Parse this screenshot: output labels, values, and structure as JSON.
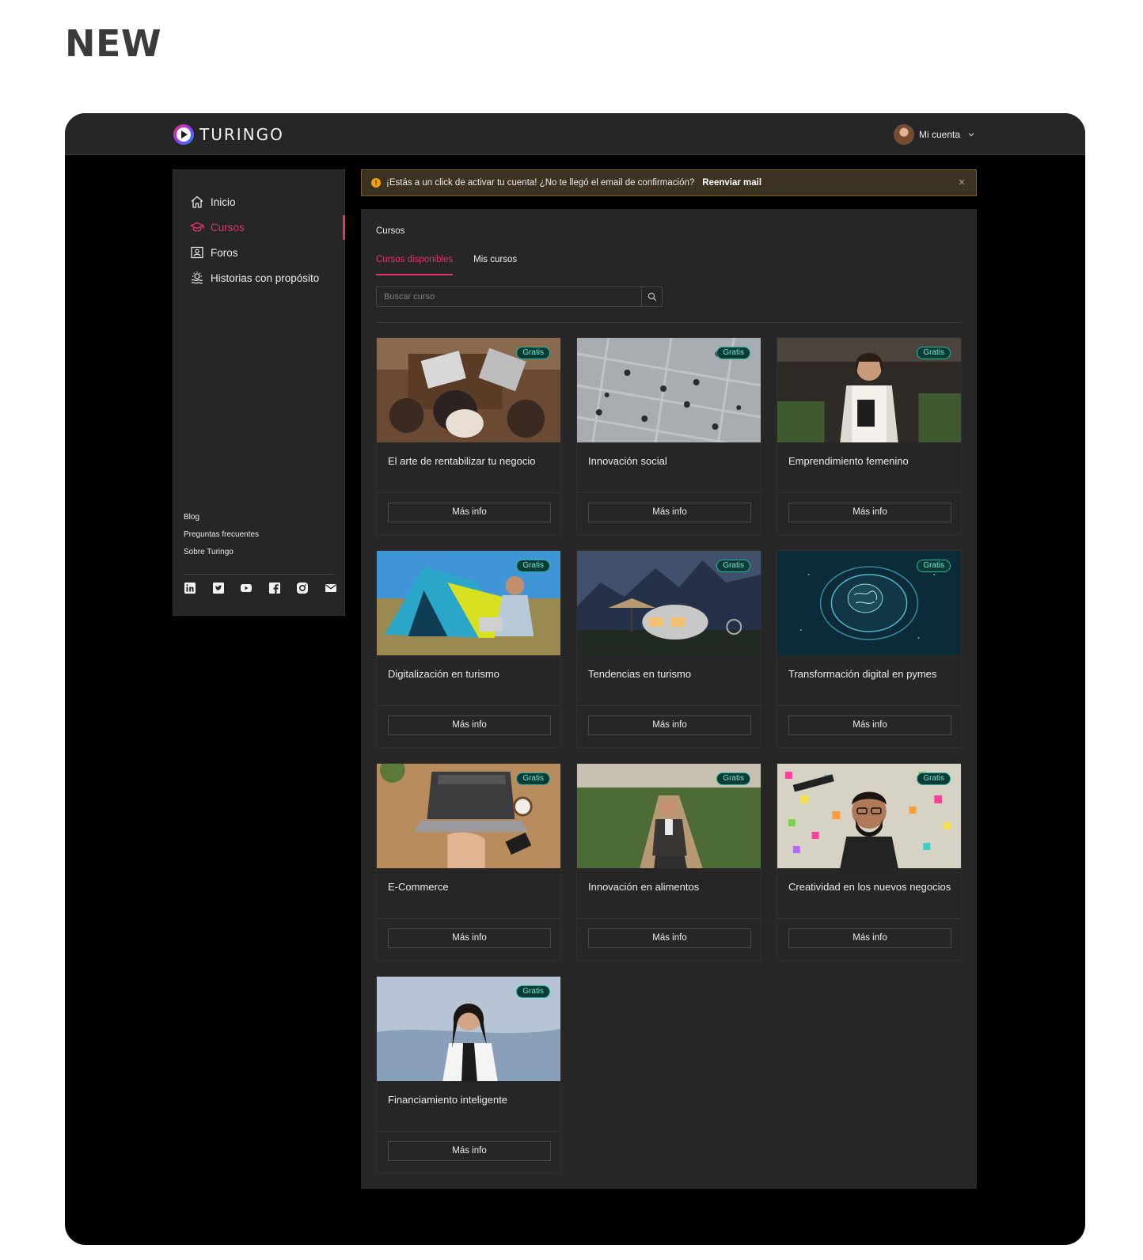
{
  "heading": "NEW",
  "brand": {
    "name": "TURINGO"
  },
  "account": {
    "label": "Mi cuenta"
  },
  "sidebar": {
    "items": [
      {
        "label": "Inicio",
        "icon": "home-icon",
        "active": false
      },
      {
        "label": "Cursos",
        "icon": "graduation-cap-icon",
        "active": true
      },
      {
        "label": "Foros",
        "icon": "forum-icon",
        "active": false
      },
      {
        "label": "Historias con propósito",
        "icon": "sunrise-icon",
        "active": false
      }
    ],
    "footer_links": [
      "Blog",
      "Preguntas frecuentes",
      "Sobre Turingo"
    ],
    "socials": [
      "linkedin-icon",
      "twitter-icon",
      "youtube-icon",
      "facebook-icon",
      "instagram-icon",
      "mail-icon"
    ]
  },
  "alert": {
    "message": "¡Estás a un click de activar tu cuenta! ¿No te llegó el email de confirmación?",
    "action": "Reenviar mail",
    "color": "#f0a20a"
  },
  "main": {
    "title": "Cursos",
    "tabs": [
      {
        "label": "Cursos disponibles",
        "active": true
      },
      {
        "label": "Mis cursos",
        "active": false
      }
    ],
    "search": {
      "placeholder": "Buscar curso"
    },
    "courses": [
      {
        "title": "El arte de rentabilizar tu negocio",
        "badge": "Gratis",
        "button": "Más info"
      },
      {
        "title": "Innovación social",
        "badge": "Gratis",
        "button": "Más info"
      },
      {
        "title": "Emprendimiento femenino",
        "badge": "Gratis",
        "button": "Más info"
      },
      {
        "title": "Digitalización en turismo",
        "badge": "Gratis",
        "button": "Más info"
      },
      {
        "title": "Tendencias en turismo",
        "badge": "Gratis",
        "button": "Más info"
      },
      {
        "title": "Transformación digital en pymes",
        "badge": "Gratis",
        "button": "Más info"
      },
      {
        "title": "E-Commerce",
        "badge": "Gratis",
        "button": "Más info"
      },
      {
        "title": "Innovación en alimentos",
        "badge": "Gratis",
        "button": "Más info"
      },
      {
        "title": "Creatividad en los nuevos negocios",
        "badge": "Gratis",
        "button": "Más info"
      },
      {
        "title": "Financiamiento inteligente",
        "badge": "Gratis",
        "button": "Más info"
      }
    ]
  },
  "colors": {
    "accent": "#e0356a",
    "badge": "#27b59a",
    "surface": "#262626",
    "background": "#000000"
  }
}
